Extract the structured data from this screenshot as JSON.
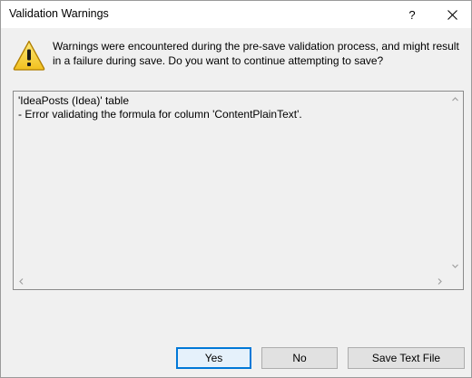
{
  "window": {
    "title": "Validation Warnings",
    "help_label": "?",
    "close_icon": "close-icon"
  },
  "message": {
    "icon": "warning-icon",
    "text": "Warnings were encountered during the pre-save validation process, and might result in a failure during save. Do you want to continue attempting to save?"
  },
  "details": {
    "lines": [
      "'IdeaPosts (Idea)' table",
      "- Error validating the formula for column 'ContentPlainText'."
    ]
  },
  "buttons": {
    "yes": "Yes",
    "no": "No",
    "save_text_file": "Save Text File"
  },
  "colors": {
    "accent": "#0078d7",
    "warning_fill": "#f7d33a",
    "warning_outline": "#b07d00"
  }
}
